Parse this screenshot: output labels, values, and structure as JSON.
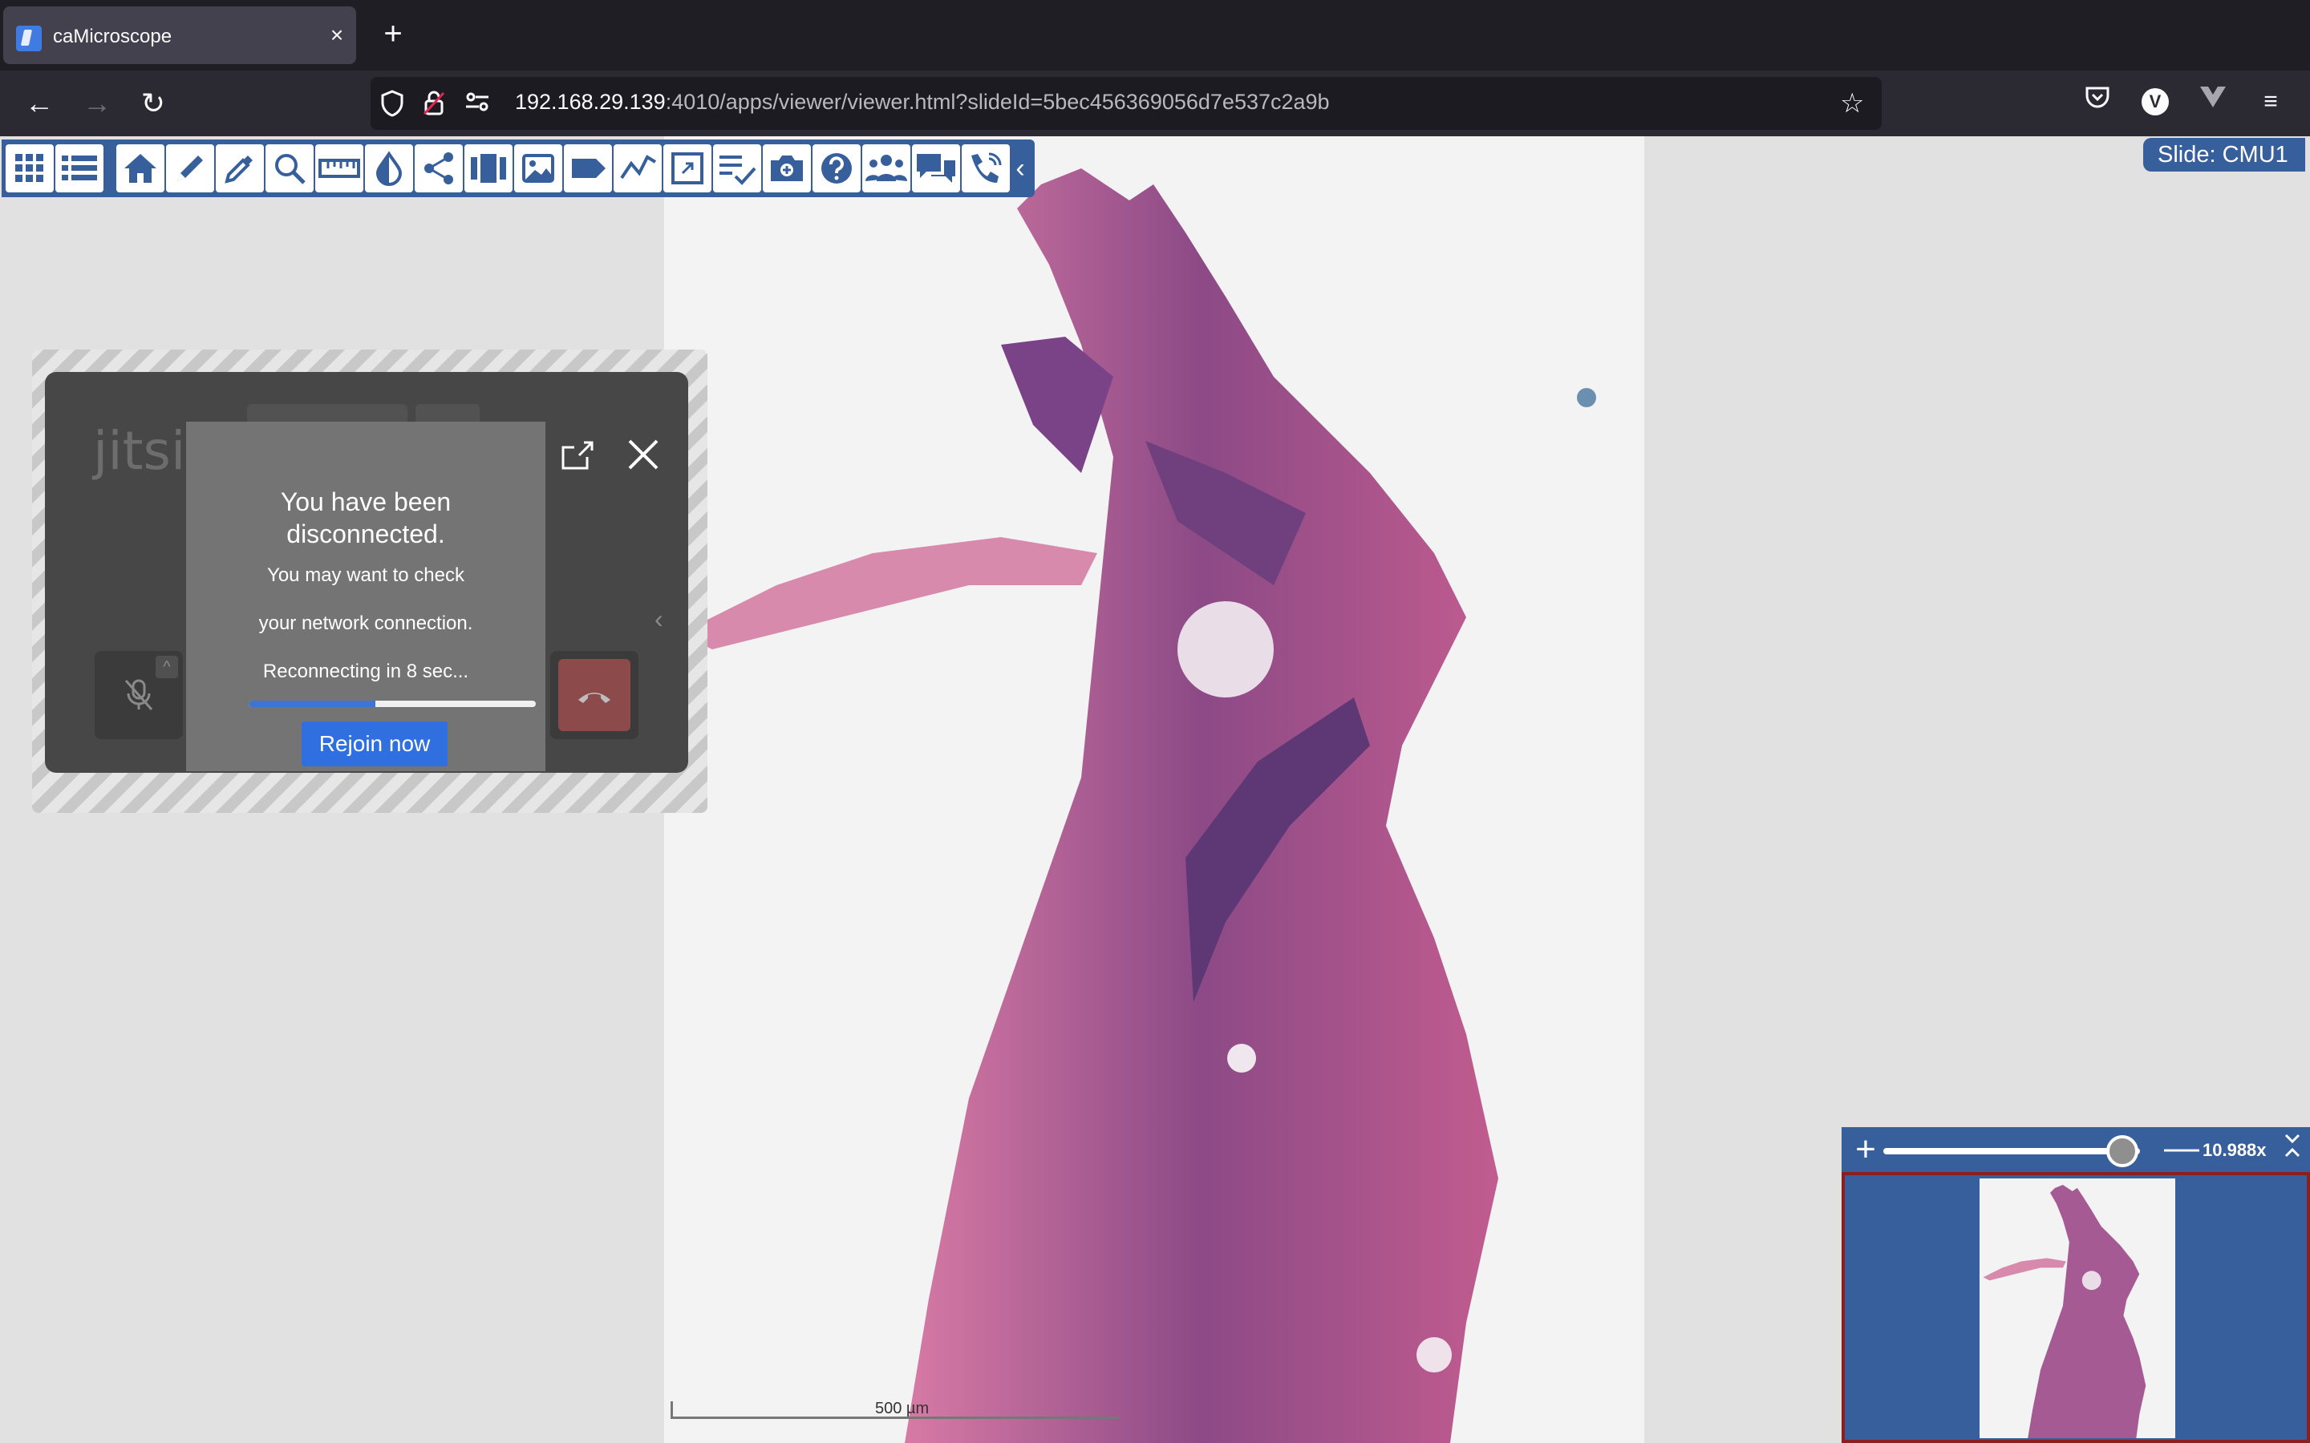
{
  "browser": {
    "tab_title": "caMicroscope",
    "tab_close": "×",
    "new_tab": "+",
    "back": "←",
    "forward": "→",
    "reload": "↻",
    "url_host": "192.168.29.139",
    "url_rest": ":4010/apps/viewer/viewer.html?slideId=5bec456369056d7e537c2a9b",
    "bookmark_star": "☆",
    "profile_initial": "V",
    "menu": "≡"
  },
  "app": {
    "slide_label": "Slide: CMU1",
    "toolbar_icons": [
      "apps-grid-icon",
      "layers-list-icon",
      "home-icon",
      "pencil-icon",
      "eyedropper-icon",
      "magnifier-icon",
      "ruler-icon",
      "color-drop-icon",
      "share-icon",
      "side-by-side-icon",
      "image-icon",
      "label-tag-icon",
      "polyline-icon",
      "fullscreen-icon",
      "checklist-icon",
      "camera-icon",
      "help-icon",
      "collaborators-icon",
      "chat-icon",
      "video-call-icon"
    ],
    "scale_label": "500 µm"
  },
  "jitsi": {
    "logo_text": "jitsi",
    "dialog": {
      "title": "You have been disconnected.",
      "line1": "You may want to check",
      "line2": "your network connection.",
      "countdown": "Reconnecting in 8 sec...",
      "progress": 0.44,
      "button": "Rejoin now"
    }
  },
  "zoom": {
    "value": "10.988x",
    "slider_fraction": 0.93,
    "plus": "+",
    "minus": "—"
  },
  "colors": {
    "accent": "#365f9c",
    "button_blue": "#2f6fe0",
    "navigator_border": "#8b1f1f"
  }
}
